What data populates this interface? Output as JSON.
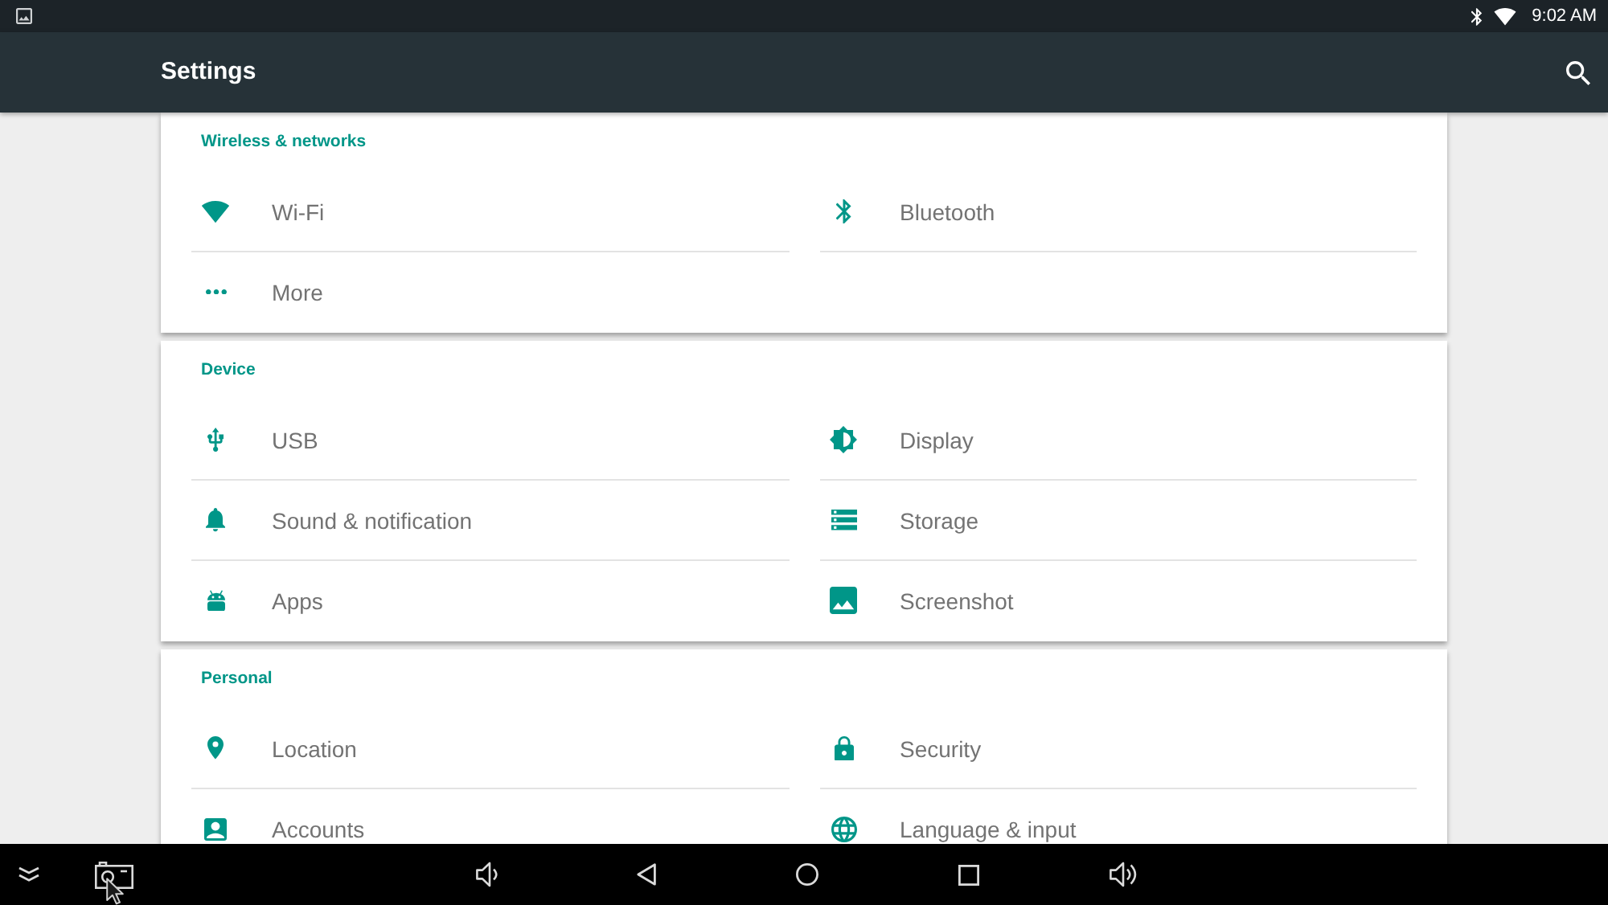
{
  "status_bar": {
    "time": "9:02 AM"
  },
  "app_bar": {
    "title": "Settings"
  },
  "sections": [
    {
      "title": "Wireless & networks",
      "items": [
        {
          "label": "Wi-Fi",
          "kind": "wifi"
        },
        {
          "label": "Bluetooth",
          "kind": "bluetooth"
        },
        {
          "label": "More",
          "kind": "more"
        }
      ]
    },
    {
      "title": "Device",
      "items": [
        {
          "label": "USB",
          "kind": "usb"
        },
        {
          "label": "Display",
          "kind": "display"
        },
        {
          "label": "Sound & notification",
          "kind": "sound"
        },
        {
          "label": "Storage",
          "kind": "storage"
        },
        {
          "label": "Apps",
          "kind": "apps"
        },
        {
          "label": "Screenshot",
          "kind": "screenshot"
        }
      ]
    },
    {
      "title": "Personal",
      "items": [
        {
          "label": "Location",
          "kind": "location"
        },
        {
          "label": "Security",
          "kind": "security"
        },
        {
          "label": "Accounts",
          "kind": "accounts"
        },
        {
          "label": "Language & input",
          "kind": "language"
        }
      ]
    }
  ]
}
